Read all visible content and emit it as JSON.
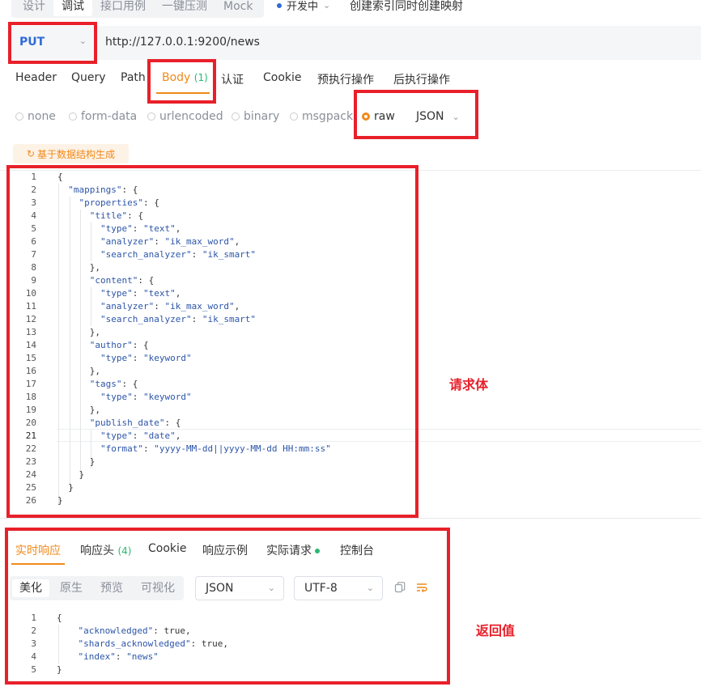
{
  "top_tabs": [
    "设计",
    "调试",
    "接口用例",
    "一键压测",
    "Mock"
  ],
  "active_top_tab": "调试",
  "status": "开发中",
  "api_name": "创建索引同时创建映射",
  "request": {
    "method": "PUT",
    "url": "http://127.0.0.1:9200/news"
  },
  "request_tabs": {
    "header": "Header",
    "query": "Query",
    "path": "Path",
    "body": "Body",
    "body_count": "(1)",
    "auth": "认证",
    "cookie": "Cookie",
    "pre": "预执行操作",
    "post": "后执行操作"
  },
  "body_types": {
    "none": "none",
    "form_data": "form-data",
    "urlencoded": "urlencoded",
    "binary": "binary",
    "msgpack": "msgpack",
    "raw": "raw",
    "format": "JSON"
  },
  "generate_button": "基于数据结构生成",
  "request_body_lines": [
    "{",
    "  \"mappings\": {",
    "    \"properties\": {",
    "      \"title\": {",
    "        \"type\": \"text\",",
    "        \"analyzer\": \"ik_max_word\",",
    "        \"search_analyzer\": \"ik_smart\"",
    "      },",
    "      \"content\": {",
    "        \"type\": \"text\",",
    "        \"analyzer\": \"ik_max_word\",",
    "        \"search_analyzer\": \"ik_smart\"",
    "      },",
    "      \"author\": {",
    "        \"type\": \"keyword\"",
    "      },",
    "      \"tags\": {",
    "        \"type\": \"keyword\"",
    "      },",
    "      \"publish_date\": {",
    "        \"type\": \"date\",",
    "        \"format\": \"yyyy-MM-dd||yyyy-MM-dd HH:mm:ss\"",
    "      }",
    "    }",
    "  }",
    "}"
  ],
  "active_line": 21,
  "annotations": {
    "request_body": "请求体",
    "response": "返回值"
  },
  "response_tabs": {
    "live": "实时响应",
    "headers": "响应头",
    "headers_count": "(4)",
    "cookie": "Cookie",
    "example": "响应示例",
    "actual": "实际请求",
    "console": "控制台"
  },
  "view_modes": [
    "美化",
    "原生",
    "预览",
    "可视化"
  ],
  "response_format": "JSON",
  "response_encoding": "UTF-8",
  "response_lines": [
    "{",
    "    \"acknowledged\": true,",
    "    \"shards_acknowledged\": true,",
    "    \"index\": \"news\"",
    "}"
  ],
  "colors": {
    "accent": "#f08a1c",
    "method": "#2f6bd8",
    "annotation": "#e8202a",
    "success": "#2bb673"
  }
}
